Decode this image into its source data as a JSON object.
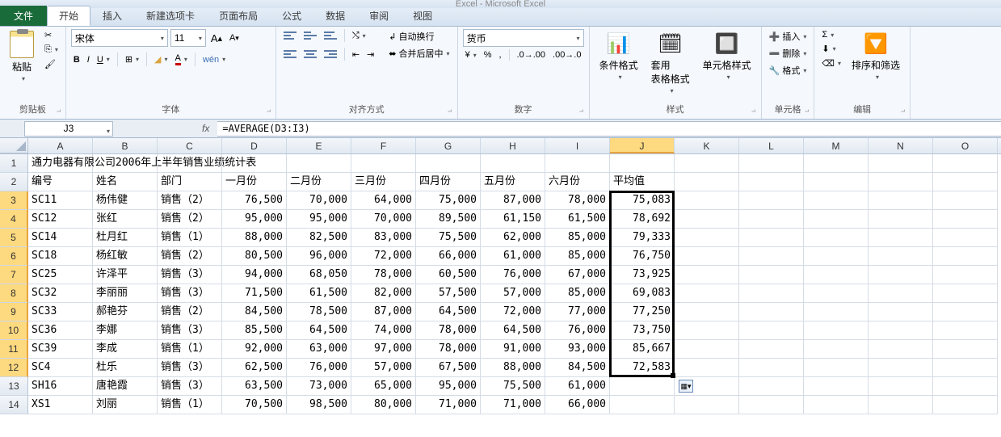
{
  "window_title": "Excel - Microsoft Excel",
  "tabs": {
    "file": "文件",
    "home": "开始",
    "insert": "插入",
    "newtab": "新建选项卡",
    "layout": "页面布局",
    "formula": "公式",
    "data": "数据",
    "review": "审阅",
    "view": "视图"
  },
  "ribbon": {
    "clipboard": {
      "paste": "粘贴",
      "label": "剪贴板"
    },
    "font": {
      "name": "宋体",
      "size": "11",
      "label": "字体"
    },
    "align": {
      "wrap": "自动换行",
      "merge": "合并后居中",
      "label": "对齐方式"
    },
    "number": {
      "format": "货币",
      "label": "数字"
    },
    "styles": {
      "cond": "条件格式",
      "table": "套用\n表格格式",
      "cell": "单元格样式",
      "label": "样式"
    },
    "cells": {
      "insert": "插入",
      "delete": "删除",
      "format": "格式",
      "label": "单元格"
    },
    "edit": {
      "sort": "排序和筛选",
      "label": "编辑"
    }
  },
  "namebox": "J3",
  "formula": "=AVERAGE(D3:I3)",
  "cols": [
    "A",
    "B",
    "C",
    "D",
    "E",
    "F",
    "G",
    "H",
    "I",
    "J",
    "K",
    "L",
    "M",
    "N",
    "O"
  ],
  "selected_col": 9,
  "selected_rows": [
    3,
    12
  ],
  "title_row": "通力电器有限公司2006年上半年销售业绩统计表",
  "headers": [
    "编号",
    "姓名",
    "部门",
    "一月份",
    "二月份",
    "三月份",
    "四月份",
    "五月份",
    "六月份",
    "平均值"
  ],
  "rows": [
    {
      "r": 3,
      "id": "SC11",
      "name": "杨伟健",
      "dept": "销售（2）",
      "m": [
        "76,500",
        "70,000",
        "64,000",
        "75,000",
        "87,000",
        "78,000"
      ],
      "avg": "75,083"
    },
    {
      "r": 4,
      "id": "SC12",
      "name": "张红",
      "dept": "销售（2）",
      "m": [
        "95,000",
        "95,000",
        "70,000",
        "89,500",
        "61,150",
        "61,500"
      ],
      "avg": "78,692"
    },
    {
      "r": 5,
      "id": "SC14",
      "name": "杜月红",
      "dept": "销售（1）",
      "m": [
        "88,000",
        "82,500",
        "83,000",
        "75,500",
        "62,000",
        "85,000"
      ],
      "avg": "79,333"
    },
    {
      "r": 6,
      "id": "SC18",
      "name": "杨红敏",
      "dept": "销售（2）",
      "m": [
        "80,500",
        "96,000",
        "72,000",
        "66,000",
        "61,000",
        "85,000"
      ],
      "avg": "76,750"
    },
    {
      "r": 7,
      "id": "SC25",
      "name": "许泽平",
      "dept": "销售（3）",
      "m": [
        "94,000",
        "68,050",
        "78,000",
        "60,500",
        "76,000",
        "67,000"
      ],
      "avg": "73,925"
    },
    {
      "r": 8,
      "id": "SC32",
      "name": "李丽丽",
      "dept": "销售（3）",
      "m": [
        "71,500",
        "61,500",
        "82,000",
        "57,500",
        "57,000",
        "85,000"
      ],
      "avg": "69,083"
    },
    {
      "r": 9,
      "id": "SC33",
      "name": "郝艳芬",
      "dept": "销售（2）",
      "m": [
        "84,500",
        "78,500",
        "87,000",
        "64,500",
        "72,000",
        "77,000"
      ],
      "avg": "77,250"
    },
    {
      "r": 10,
      "id": "SC36",
      "name": "李娜",
      "dept": "销售（3）",
      "m": [
        "85,500",
        "64,500",
        "74,000",
        "78,000",
        "64,500",
        "76,000"
      ],
      "avg": "73,750"
    },
    {
      "r": 11,
      "id": "SC39",
      "name": "李成",
      "dept": "销售（1）",
      "m": [
        "92,000",
        "63,000",
        "97,000",
        "78,000",
        "91,000",
        "93,000"
      ],
      "avg": "85,667"
    },
    {
      "r": 12,
      "id": "SC4",
      "name": "杜乐",
      "dept": "销售（3）",
      "m": [
        "62,500",
        "76,000",
        "57,000",
        "67,500",
        "88,000",
        "84,500"
      ],
      "avg": "72,583"
    },
    {
      "r": 13,
      "id": "SH16",
      "name": "唐艳霞",
      "dept": "销售（3）",
      "m": [
        "63,500",
        "73,000",
        "65,000",
        "95,000",
        "75,500",
        "61,000"
      ],
      "avg": ""
    },
    {
      "r": 14,
      "id": "XS1",
      "name": "刘丽",
      "dept": "销售（1）",
      "m": [
        "70,500",
        "98,500",
        "80,000",
        "71,000",
        "71,000",
        "66,000"
      ],
      "avg": ""
    }
  ],
  "chart_data": {
    "type": "table",
    "title": "通力电器有限公司2006年上半年销售业绩统计表",
    "columns": [
      "编号",
      "姓名",
      "部门",
      "一月份",
      "二月份",
      "三月份",
      "四月份",
      "五月份",
      "六月份",
      "平均值"
    ],
    "data": [
      [
        "SC11",
        "杨伟健",
        "销售（2）",
        76500,
        70000,
        64000,
        75000,
        87000,
        78000,
        75083
      ],
      [
        "SC12",
        "张红",
        "销售（2）",
        95000,
        95000,
        70000,
        89500,
        61150,
        61500,
        78692
      ],
      [
        "SC14",
        "杜月红",
        "销售（1）",
        88000,
        82500,
        83000,
        75500,
        62000,
        85000,
        79333
      ],
      [
        "SC18",
        "杨红敏",
        "销售（2）",
        80500,
        96000,
        72000,
        66000,
        61000,
        85000,
        76750
      ],
      [
        "SC25",
        "许泽平",
        "销售（3）",
        94000,
        68050,
        78000,
        60500,
        76000,
        67000,
        73925
      ],
      [
        "SC32",
        "李丽丽",
        "销售（3）",
        71500,
        61500,
        82000,
        57500,
        57000,
        85000,
        69083
      ],
      [
        "SC33",
        "郝艳芬",
        "销售（2）",
        84500,
        78500,
        87000,
        64500,
        72000,
        77000,
        77250
      ],
      [
        "SC36",
        "李娜",
        "销售（3）",
        85500,
        64500,
        74000,
        78000,
        64500,
        76000,
        73750
      ],
      [
        "SC39",
        "李成",
        "销售（1）",
        92000,
        63000,
        97000,
        78000,
        91000,
        93000,
        85667
      ],
      [
        "SC4",
        "杜乐",
        "销售（3）",
        62500,
        76000,
        57000,
        67500,
        88000,
        84500,
        72583
      ],
      [
        "SH16",
        "唐艳霞",
        "销售（3）",
        63500,
        73000,
        65000,
        95000,
        75500,
        61000,
        null
      ],
      [
        "XS1",
        "刘丽",
        "销售（1）",
        70500,
        98500,
        80000,
        71000,
        71000,
        66000,
        null
      ]
    ]
  }
}
